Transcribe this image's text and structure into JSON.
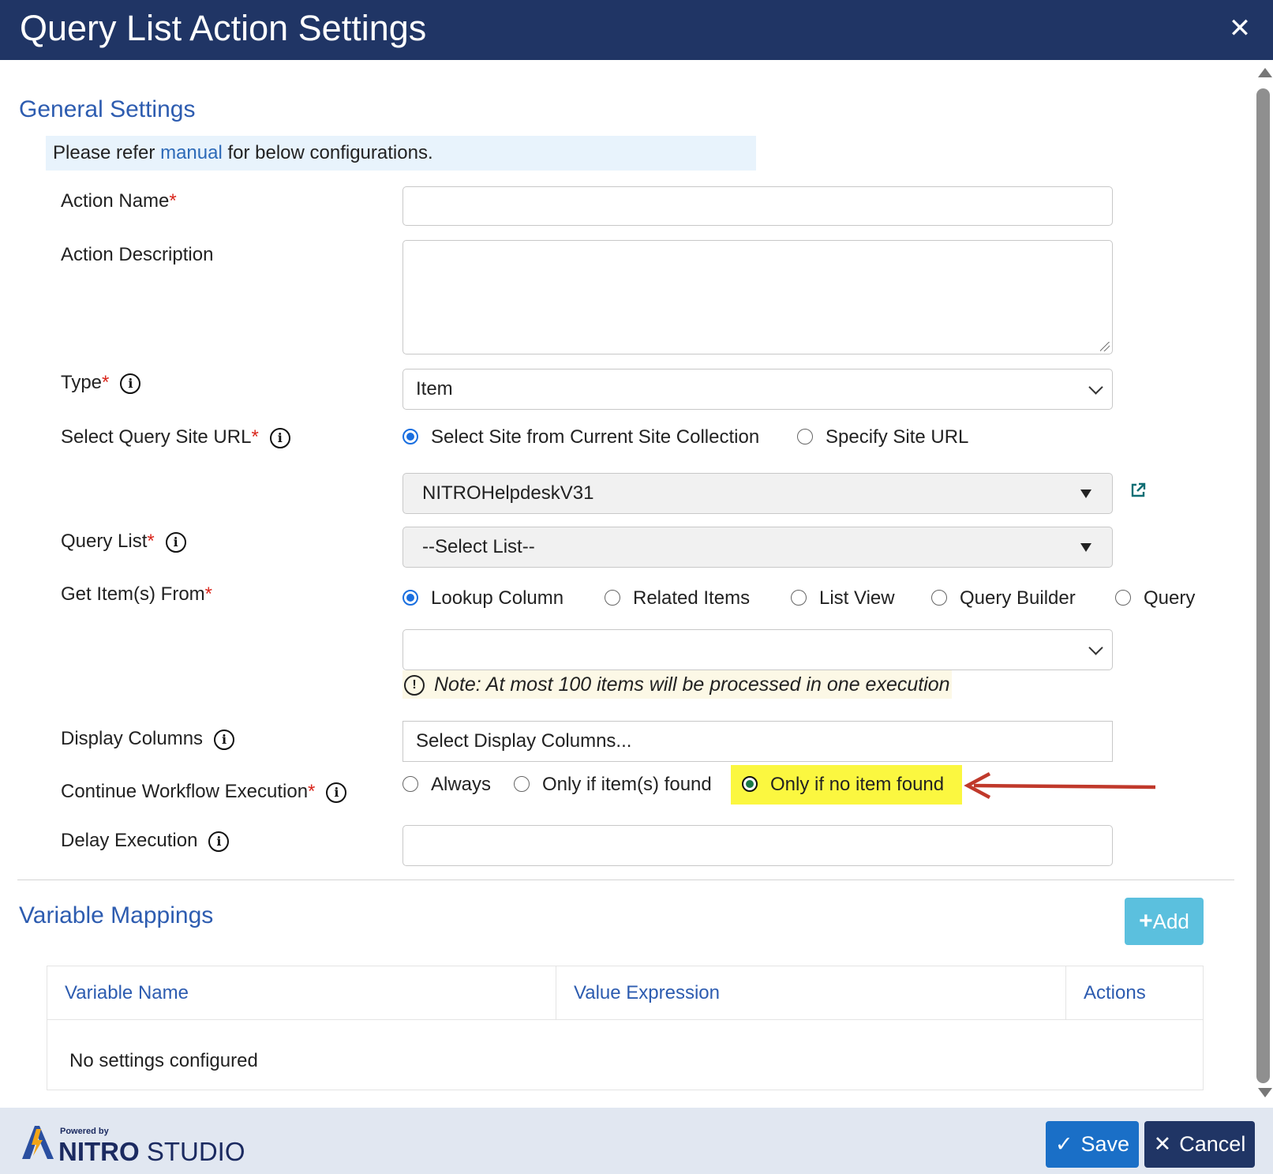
{
  "dialog": {
    "title": "Query List Action Settings",
    "close_glyph": "✕"
  },
  "general": {
    "title": "General Settings",
    "banner": {
      "prefix": "Please refer ",
      "link": "manual",
      "suffix": " for below configurations."
    }
  },
  "fields": {
    "action_name": {
      "label": "Action Name",
      "required": "*",
      "value": ""
    },
    "action_description": {
      "label": "Action Description",
      "value": ""
    },
    "type": {
      "label": "Type",
      "required": "*",
      "value": "Item"
    },
    "query_site_url": {
      "label": "Select Query Site URL",
      "required": "*",
      "options": [
        "Select Site from Current Site Collection",
        "Specify Site URL"
      ],
      "selected": "Select Site from Current Site Collection",
      "site_value": "NITROHelpdeskV31"
    },
    "query_list": {
      "label": "Query List",
      "required": "*",
      "value": "--Select List--"
    },
    "get_items_from": {
      "label": "Get Item(s) From",
      "required": "*",
      "options": [
        "Lookup Column",
        "Related Items",
        "List View",
        "Query Builder",
        "Query"
      ],
      "selected": "Lookup Column",
      "dropdown_value": "",
      "note": "Note: At most 100 items will be processed in one execution"
    },
    "display_columns": {
      "label": "Display Columns",
      "value": "Select Display Columns..."
    },
    "continue_workflow": {
      "label": "Continue Workflow Execution",
      "required": "*",
      "options": [
        "Always",
        "Only if item(s) found",
        "Only if no item found"
      ],
      "selected": "Only if no item found"
    },
    "delay_execution": {
      "label": "Delay Execution",
      "value": ""
    }
  },
  "variable_mappings": {
    "title": "Variable Mappings",
    "add_label": "Add",
    "columns": [
      "Variable Name",
      "Value Expression",
      "Actions"
    ],
    "empty_message": "No settings configured"
  },
  "footer": {
    "powered_by": "Powered by",
    "brand_bold": "NITRO",
    "brand_light": "STUDIO",
    "save_label": "Save",
    "cancel_label": "Cancel"
  },
  "colors": {
    "header_bg": "#203565",
    "section_title": "#2d5cb0",
    "highlight": "#fbf740",
    "annotation_arrow": "#c0392b",
    "add_button": "#5bc0de",
    "save_button": "#1a6fc7",
    "cancel_button": "#203565",
    "footer_bg": "#e1e7f1"
  },
  "icons": {
    "close": "close-icon",
    "info": "info-icon",
    "external_link": "external-link-icon",
    "warning": "exclamation-circle-icon",
    "plus": "plus-icon",
    "check": "checkmark-icon",
    "cancel": "x-icon"
  }
}
